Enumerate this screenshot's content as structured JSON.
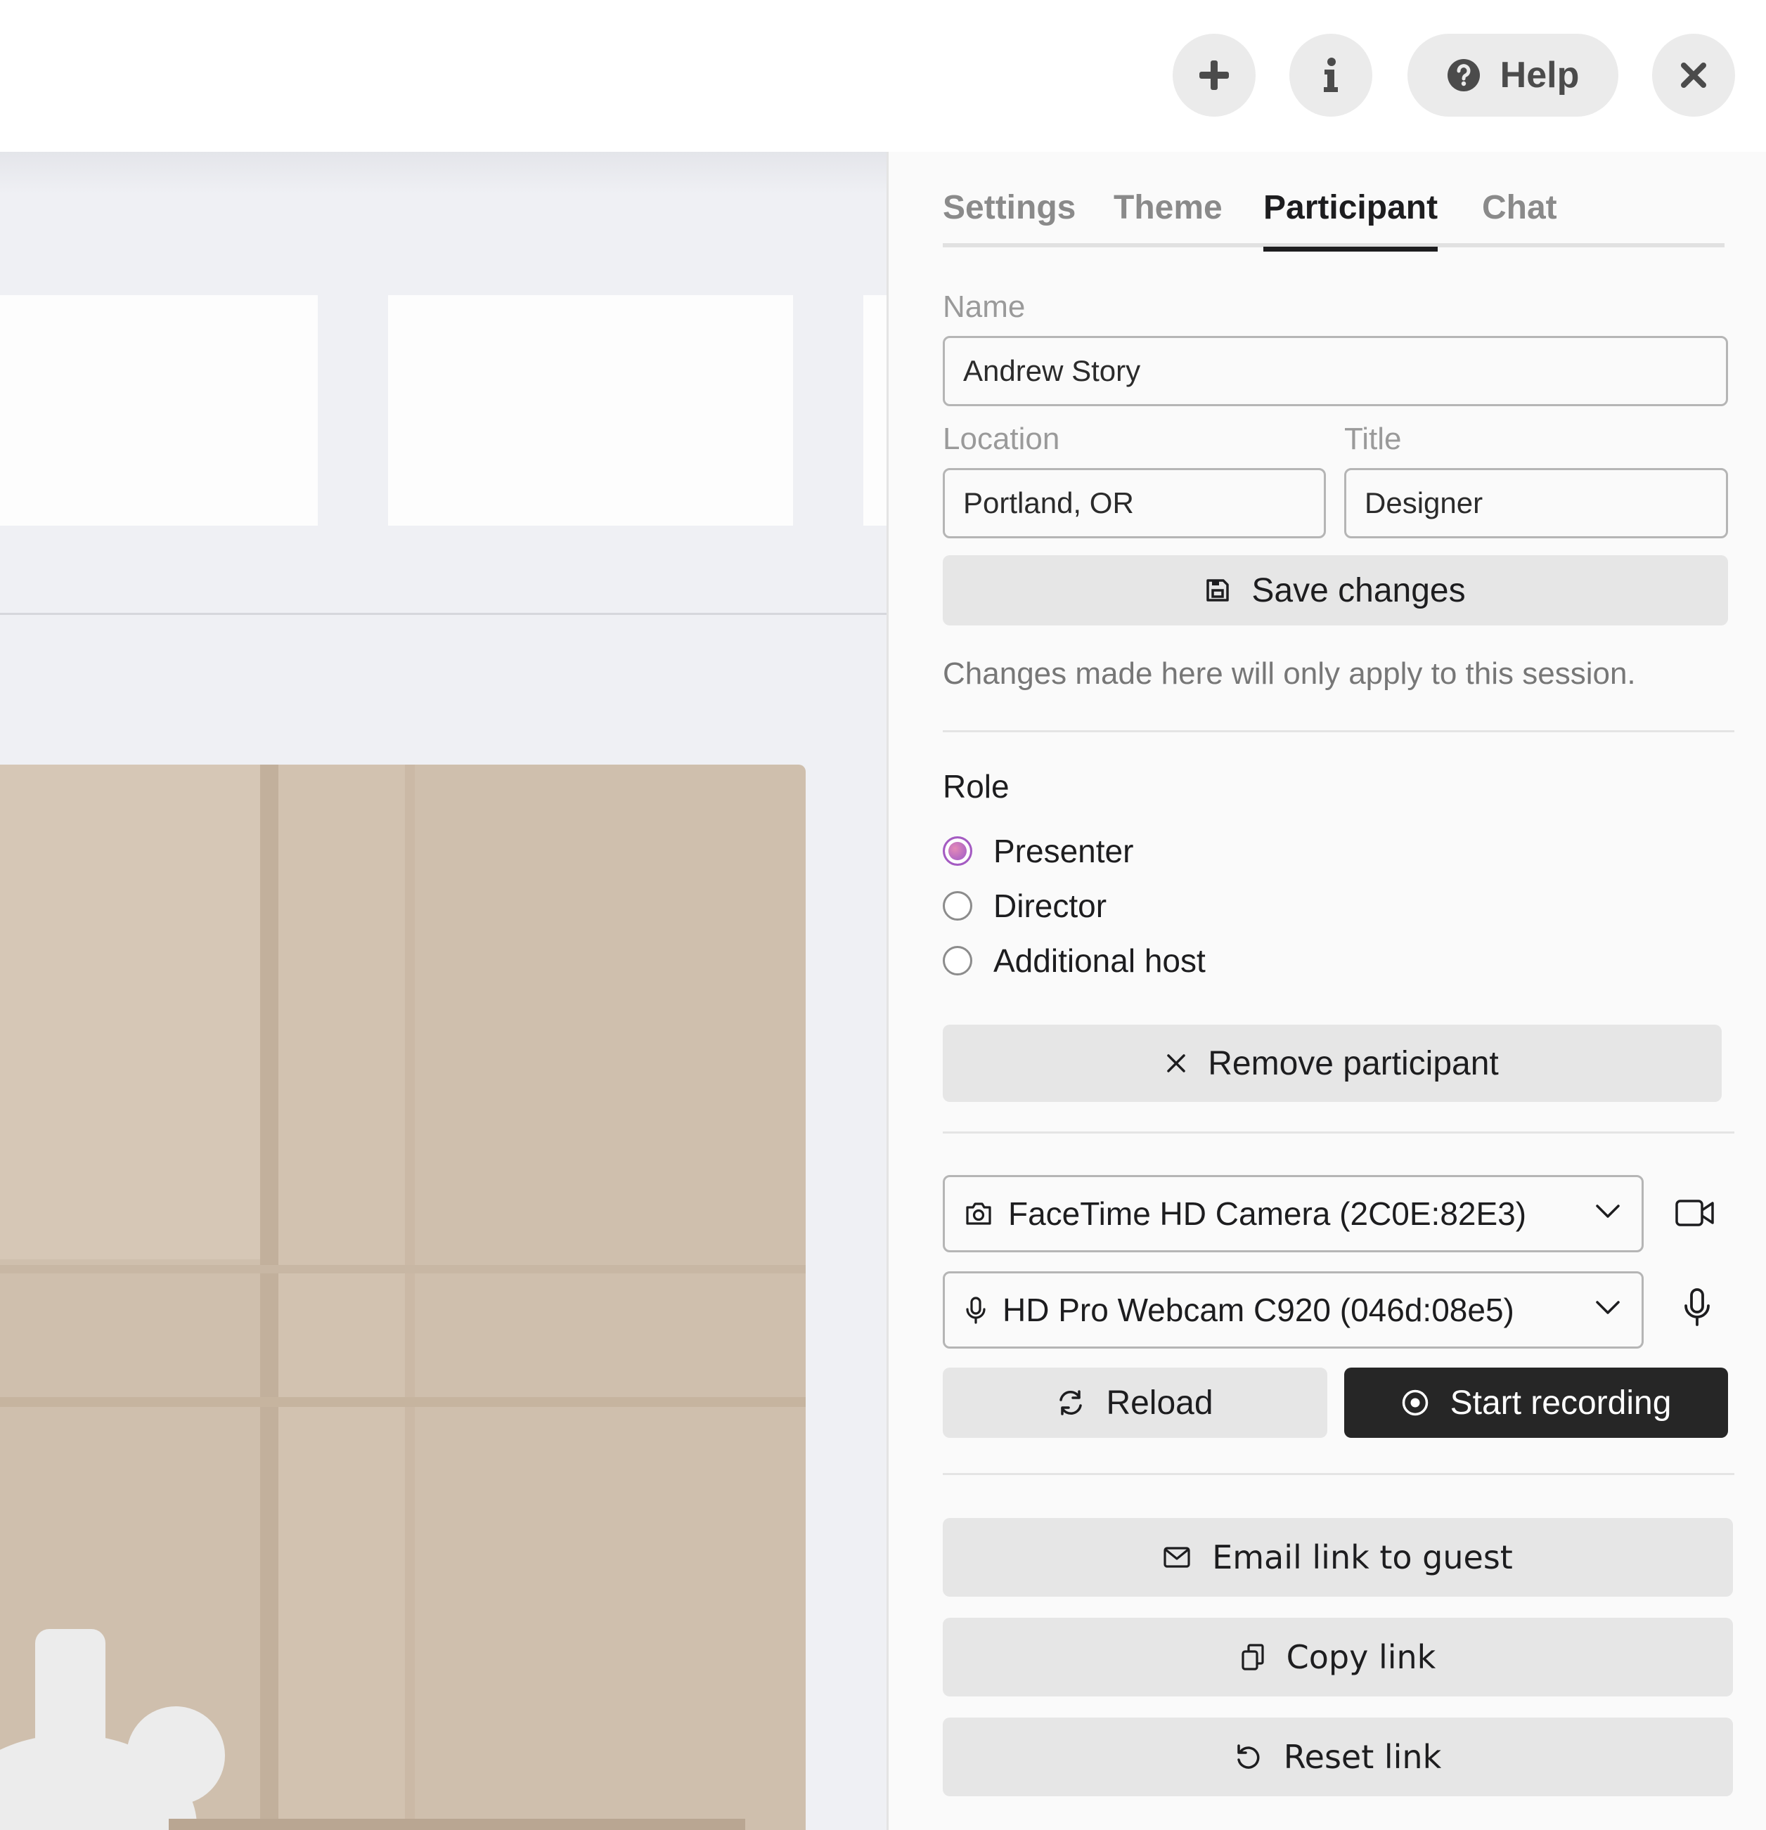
{
  "topbar": {
    "add_icon": "plus-icon",
    "info_icon": "info-icon",
    "help_label": "Help",
    "close_icon": "close-icon"
  },
  "tabs": [
    {
      "label": "Settings",
      "active": false
    },
    {
      "label": "Theme",
      "active": false
    },
    {
      "label": "Participant",
      "active": true
    },
    {
      "label": "Chat",
      "active": false
    }
  ],
  "participant": {
    "name_label": "Name",
    "name_value": "Andrew Story",
    "location_label": "Location",
    "location_value": "Portland, OR",
    "title_label": "Title",
    "title_value": "Designer",
    "save_label": "Save changes",
    "note": "Changes made here will only apply to this session."
  },
  "role": {
    "title": "Role",
    "options": [
      {
        "label": "Presenter",
        "selected": true
      },
      {
        "label": "Director",
        "selected": false
      },
      {
        "label": "Additional host",
        "selected": false
      }
    ],
    "remove_label": "Remove participant"
  },
  "devices": {
    "camera_value": "FaceTime HD Camera (2C0E:82E3)",
    "mic_value": "HD Pro Webcam C920 (046d:08e5)",
    "reload_label": "Reload",
    "record_label": "Start recording"
  },
  "links": {
    "email_label": "Email link to guest",
    "copy_label": "Copy link",
    "reset_label": "Reset link"
  },
  "colors": {
    "accent": "#262626",
    "radio_selected": "#b167c4",
    "button_bg": "#e6e6e6"
  }
}
